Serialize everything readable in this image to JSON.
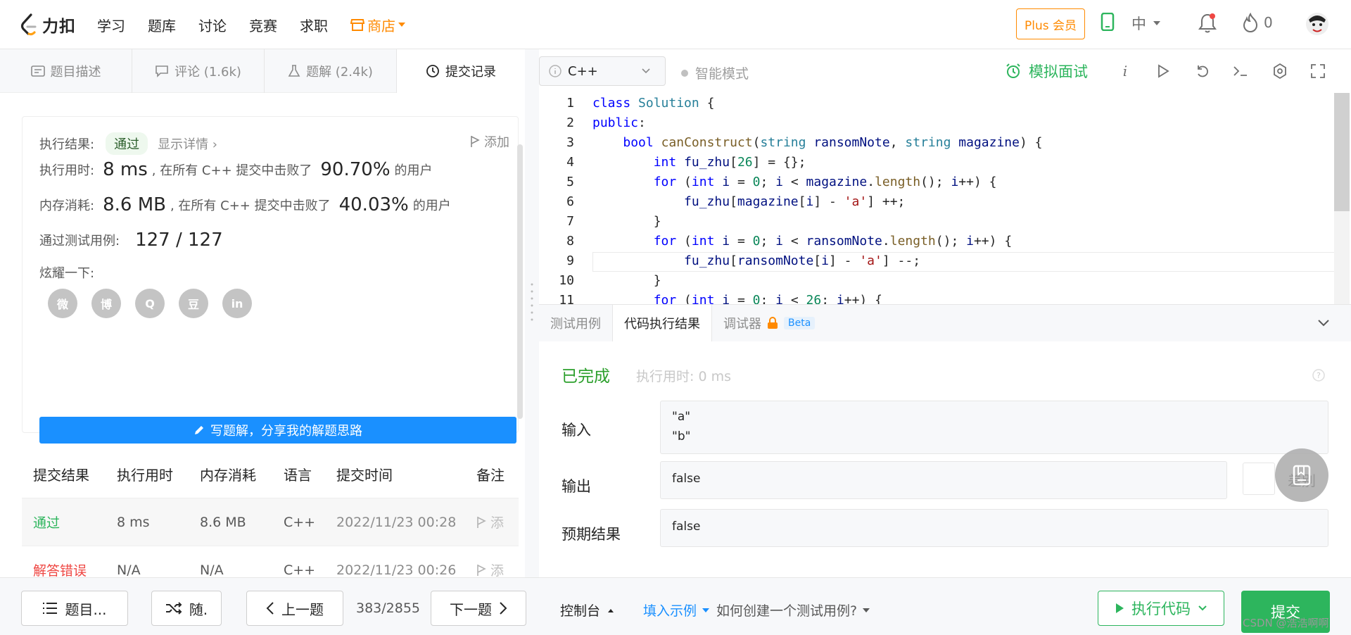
{
  "brand": {
    "logo_text": "力扣"
  },
  "nav": {
    "items": [
      "学习",
      "题库",
      "讨论",
      "竞赛",
      "求职"
    ],
    "store": "商店"
  },
  "topright": {
    "plus": "Plus 会员",
    "lang": "中",
    "streak": "0"
  },
  "left_tabs": [
    {
      "label": "题目描述"
    },
    {
      "label": "评论 (1.6k)"
    },
    {
      "label": "题解 (2.4k)"
    },
    {
      "label": "提交记录"
    }
  ],
  "result": {
    "label_result": "执行结果:",
    "status": "通过",
    "detail": "显示详情",
    "add_note": "添加",
    "label_time": "执行用时:",
    "time_value": "8 ms",
    "beat_prefix": ", 在所有 C++ 提交中击败了",
    "time_percent": "90.70%",
    "beat_suffix": "的用户",
    "label_mem": "内存消耗:",
    "mem_value": "8.6 MB",
    "mem_percent": "40.03%",
    "label_cases": "通过测试用例:",
    "cases_value": "127 / 127",
    "label_share": "炫耀一下:",
    "share_icons": [
      "微",
      "博",
      "Q",
      "豆",
      "in"
    ],
    "write_btn": "写题解，分享我的解题思路"
  },
  "table": {
    "headers": [
      "提交结果",
      "执行用时",
      "内存消耗",
      "语言",
      "提交时间",
      "备注"
    ],
    "rows": [
      {
        "status": "通过",
        "time": "8 ms",
        "mem": "8.6 MB",
        "lang": "C++",
        "date": "2022/11/23 00:28",
        "note": "添"
      },
      {
        "status": "解答错误",
        "time": "N/A",
        "mem": "N/A",
        "lang": "C++",
        "date": "2022/11/23 00:26",
        "note": "添"
      }
    ]
  },
  "editor": {
    "language": "C++",
    "smart_mode": "智能模式",
    "mock": "模拟面试",
    "line_numbers": [
      "1",
      "2",
      "3",
      "4",
      "5",
      "6",
      "7",
      "8",
      "9",
      "10",
      "11"
    ]
  },
  "panel": {
    "tabs": [
      "测试用例",
      "代码执行结果",
      "调试器"
    ],
    "beta": "Beta",
    "done": "已完成",
    "elapsed": "执行用时: 0 ms",
    "input_label": "输入",
    "input_lines": [
      "\"a\"",
      "\"b\""
    ],
    "output_label": "输出",
    "output_value": "false",
    "diff_label": "差别",
    "expected_label": "预期结果",
    "expected_value": "false"
  },
  "bottom": {
    "list_btn": "题目...",
    "random_btn": "随.",
    "prev_btn": "上一题",
    "counter": "383/2855",
    "next_btn": "下一题",
    "console": "控制台",
    "fill_example": "填入示例",
    "how_create": "如何创建一个测试用例?",
    "run": "执行代码",
    "submit": "提交"
  },
  "watermark": "CSDN @浩浩啊啊",
  "colors": {
    "accent_green": "#2db55d",
    "store_orange": "#ff8a00",
    "blue": "#1a90ff",
    "error_red": "#ef4743"
  }
}
